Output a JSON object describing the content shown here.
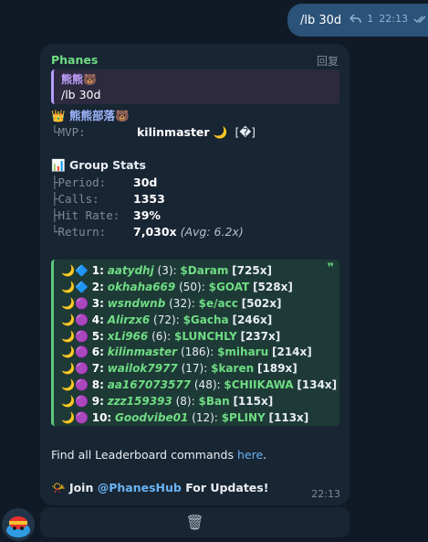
{
  "outgoing": {
    "text": "/lb 30d",
    "reply_count": "1",
    "time": "22:13"
  },
  "message": {
    "sender": "Phanes",
    "reply_label": "回复",
    "quote": {
      "author": "熊熊🐻",
      "text": "/lb 30d"
    },
    "group": {
      "crown": "👑",
      "name": "熊熊部落🐻",
      "mvp_label": "└MVP:",
      "mvp_value": "kilinmaster 🌙",
      "mvp_extra": "[�]"
    },
    "stats": {
      "icon": "📊",
      "title": "Group Stats",
      "rows": [
        {
          "label": "├Period:",
          "value": "30d",
          "extra": ""
        },
        {
          "label": "├Calls:",
          "value": "1353",
          "extra": ""
        },
        {
          "label": "├Hit Rate:",
          "value": "39%",
          "extra": ""
        },
        {
          "label": "└Return:",
          "value": "7,030x",
          "extra": "(Avg: 6.2x)"
        }
      ]
    },
    "leaderboard": [
      {
        "icons": "🌙🔷",
        "rank": "1:",
        "user": "aatydhj",
        "count": "(3):",
        "ticker": "$Daram",
        "mult": "[725x]"
      },
      {
        "icons": "🌙🔷",
        "rank": "2:",
        "user": "okhaha669",
        "count": "(50):",
        "ticker": "$GOAT",
        "mult": "[528x]"
      },
      {
        "icons": "🌙🟣",
        "rank": "3:",
        "user": "wsndwnb",
        "count": "(32):",
        "ticker": "$e/acc",
        "mult": "[502x]"
      },
      {
        "icons": "🌙🟣",
        "rank": "4:",
        "user": "Alirzx6",
        "count": "(72):",
        "ticker": "$Gacha",
        "mult": "[246x]"
      },
      {
        "icons": "🌙🟣",
        "rank": "5:",
        "user": "xLi966",
        "count": "(6):",
        "ticker": "$LUNCHLY",
        "mult": "[237x]"
      },
      {
        "icons": "🌙🟣",
        "rank": "6:",
        "user": "kilinmaster",
        "count": "(186):",
        "ticker": "$miharu",
        "mult": "[214x]"
      },
      {
        "icons": "🌙🟣",
        "rank": "7:",
        "user": "wailok7977",
        "count": "(17):",
        "ticker": "$karen",
        "mult": "[189x]"
      },
      {
        "icons": "🌙🟣",
        "rank": "8:",
        "user": "aa167073577",
        "count": "(48):",
        "ticker": "$CHIIKAWA",
        "mult": "[134x]"
      },
      {
        "icons": "🌙🟣",
        "rank": "9:",
        "user": "zzz159393",
        "count": "(8):",
        "ticker": "$Ban",
        "mult": "[115x]"
      },
      {
        "icons": "🌙🟣",
        "rank": "10:",
        "user": "Goodvibe01",
        "count": "(12):",
        "ticker": "$PLINY",
        "mult": "[113x]"
      }
    ],
    "find_text": "Find all Leaderboard commands ",
    "find_link": "here",
    "find_end": ".",
    "join_icon": "📯",
    "join_prefix": "Join ",
    "join_link": "@PhanesHub",
    "join_suffix": " For Updates!",
    "time": "22:13"
  },
  "actions": {
    "delete_icon": "🗑"
  },
  "colors": {
    "bg": "#0f1a26",
    "bubble": "#182533",
    "outgoing": "#2b5278",
    "accent_green": "#6fdc84",
    "link": "#6ab2f2"
  }
}
